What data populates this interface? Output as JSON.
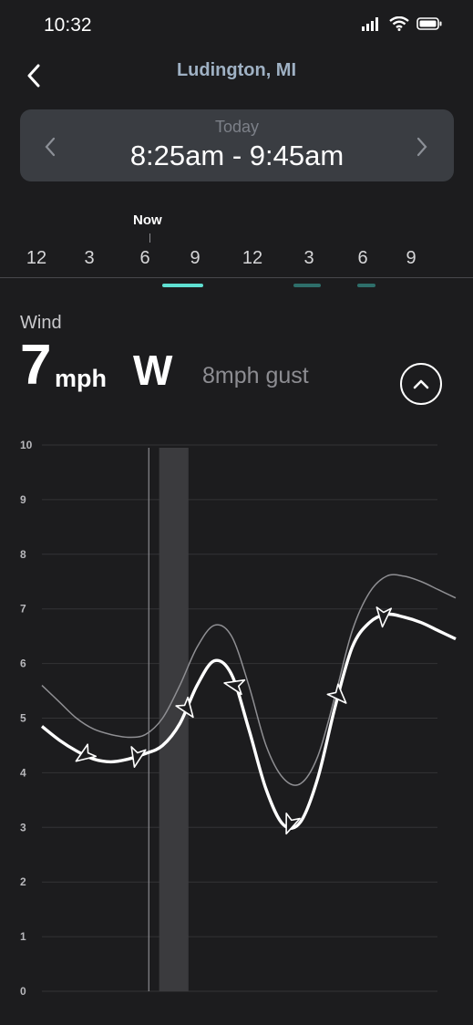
{
  "status_bar": {
    "time": "10:32"
  },
  "header": {
    "title": "Ludington, MI"
  },
  "selector": {
    "day": "Today",
    "range": "8:25am - 9:45am"
  },
  "timeline": {
    "now_label": "Now",
    "hours": [
      "12",
      "3",
      "6",
      "9",
      "12",
      "3",
      "6",
      "9"
    ]
  },
  "wind": {
    "label": "Wind",
    "speed": "7",
    "unit": "mph",
    "direction": "W",
    "gust": "8mph gust"
  },
  "colors": {
    "background": "#1c1c1e",
    "title": "#9fb1c4",
    "selector_bg": "#3a3d42",
    "marker_active": "#5fe0d2",
    "marker_inactive": "#2e6e6a"
  },
  "chart_data": {
    "type": "line",
    "y_ticks": [
      "10",
      "9",
      "8",
      "7",
      "6",
      "5",
      "4",
      "3",
      "2",
      "1",
      "0"
    ],
    "ylim": [
      0,
      10
    ],
    "xlim": [
      0,
      24
    ],
    "grid": true,
    "now_hour": 6.2,
    "selected_window": [
      6.8,
      8.5
    ],
    "series": [
      {
        "values_x": [
          0,
          1,
          2,
          3,
          4,
          5,
          6,
          7,
          8,
          9,
          10,
          11,
          12,
          13,
          14,
          15,
          16,
          17,
          18,
          19,
          20,
          21,
          22,
          23,
          24
        ],
        "values_y": [
          5.6,
          5.3,
          5.0,
          4.8,
          4.7,
          4.65,
          4.7,
          5.0,
          5.6,
          6.3,
          6.7,
          6.5,
          5.6,
          4.5,
          3.9,
          3.8,
          4.3,
          5.4,
          6.6,
          7.3,
          7.6,
          7.6,
          7.5,
          7.35,
          7.2
        ],
        "style": "gust"
      },
      {
        "values_x": [
          0,
          1,
          2,
          3,
          4,
          5,
          6,
          7,
          8,
          9,
          10,
          11,
          12,
          13,
          14,
          15,
          16,
          17,
          18,
          19,
          20,
          21,
          22,
          23,
          24
        ],
        "values_y": [
          4.85,
          4.6,
          4.4,
          4.25,
          4.2,
          4.25,
          4.35,
          4.5,
          4.9,
          5.6,
          6.05,
          5.8,
          4.8,
          3.7,
          3.05,
          3.1,
          3.9,
          5.2,
          6.3,
          6.75,
          6.9,
          6.85,
          6.75,
          6.6,
          6.45
        ],
        "style": "wind"
      }
    ],
    "arrows_x": [
      2.5,
      5.5,
      8.4,
      11.2,
      14.4,
      17.2,
      19.8
    ]
  }
}
